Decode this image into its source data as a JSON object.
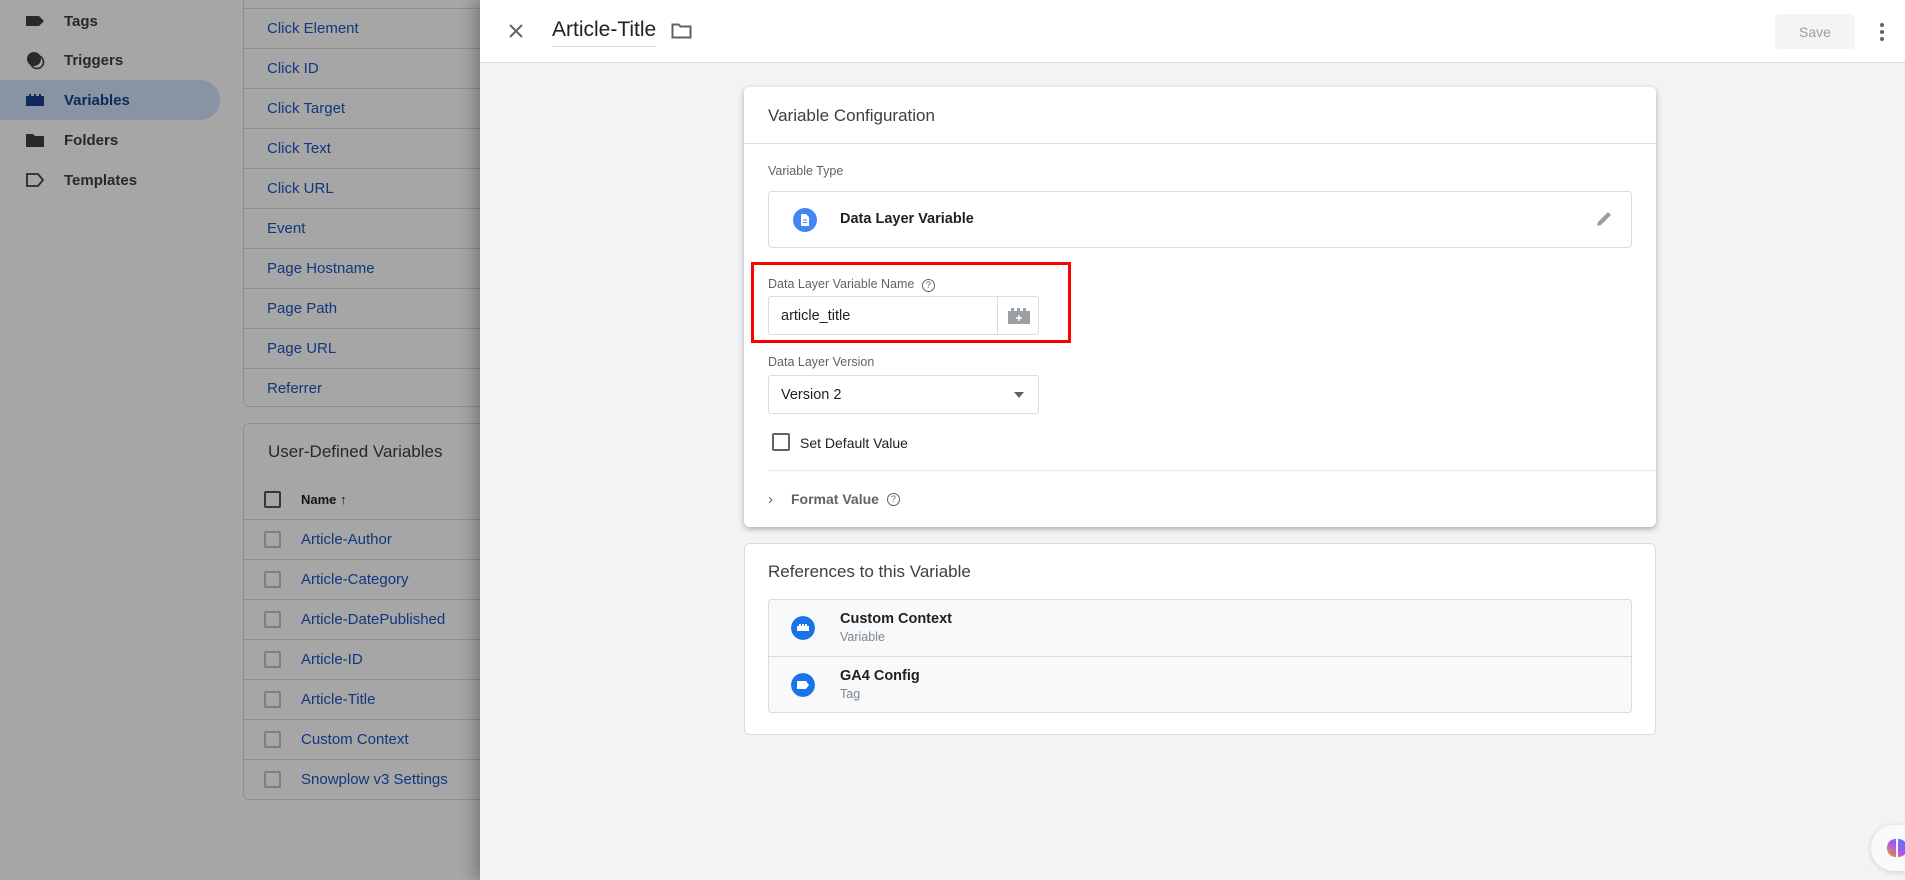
{
  "sidebar": {
    "items": [
      {
        "label": "Tags",
        "icon": "tag-icon"
      },
      {
        "label": "Triggers",
        "icon": "trigger-icon"
      },
      {
        "label": "Variables",
        "icon": "variables-icon",
        "active": true
      },
      {
        "label": "Folders",
        "icon": "folder-icon"
      },
      {
        "label": "Templates",
        "icon": "template-icon"
      }
    ]
  },
  "builtin": {
    "items": [
      "Click Element",
      "Click ID",
      "Click Target",
      "Click Text",
      "Click URL",
      "Event",
      "Page Hostname",
      "Page Path",
      "Page URL",
      "Referrer"
    ]
  },
  "user_defined": {
    "title": "User-Defined Variables",
    "column": "Name",
    "sort": "↑",
    "items": [
      "Article-Author",
      "Article-Category",
      "Article-DatePublished",
      "Article-ID",
      "Article-Title",
      "Custom Context",
      "Snowplow v3 Settings"
    ]
  },
  "header": {
    "title": "Article-Title",
    "save_label": "Save"
  },
  "config": {
    "title": "Variable Configuration",
    "type_label": "Variable Type",
    "type_value": "Data Layer Variable",
    "name_label": "Data Layer Variable Name",
    "name_value": "article_title",
    "version_label": "Data Layer Version",
    "version_value": "Version 2",
    "default_label": "Set Default Value",
    "format_label": "Format Value"
  },
  "references": {
    "title": "References to this Variable",
    "items": [
      {
        "name": "Custom Context",
        "type": "Variable"
      },
      {
        "name": "GA4 Config",
        "type": "Tag"
      }
    ]
  },
  "colors": {
    "accent": "#1a73e8",
    "highlight": "#ff0000"
  }
}
